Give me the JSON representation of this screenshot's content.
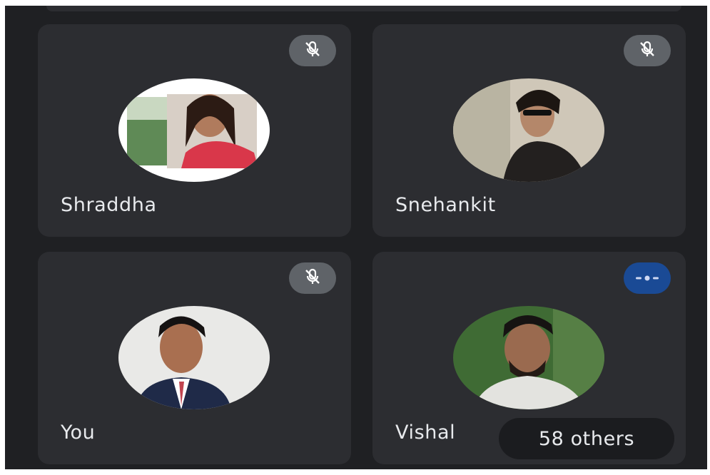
{
  "participants": [
    {
      "name": "Shraddha",
      "status": "muted",
      "status_icon": "mic-off-icon"
    },
    {
      "name": "Snehankit",
      "status": "muted",
      "status_icon": "mic-off-icon"
    },
    {
      "name": "You",
      "status": "muted",
      "status_icon": "mic-off-icon"
    },
    {
      "name": "Vishal",
      "status": "speaking",
      "status_icon": "audio-level-icon"
    }
  ],
  "others": {
    "label": "58 others"
  },
  "colors": {
    "background": "#1f2023",
    "tile": "#2c2d31",
    "muted_badge": "#5f6368",
    "speaking_badge": "#1a4a95",
    "text": "#e8eaed"
  }
}
